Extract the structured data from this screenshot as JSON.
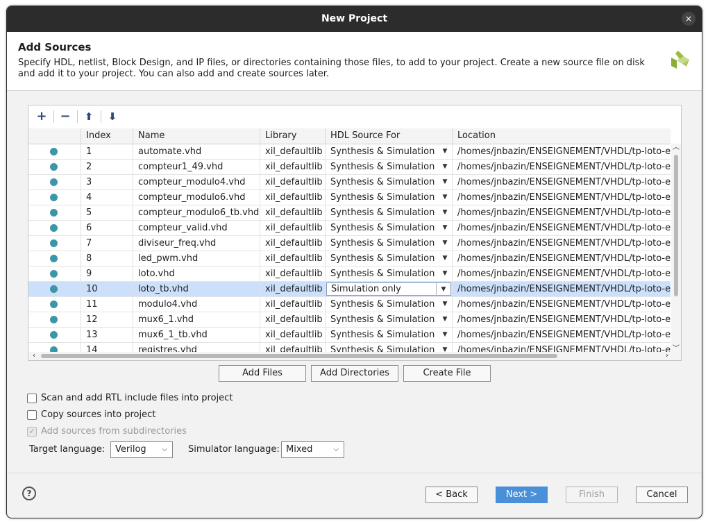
{
  "window": {
    "title": "New Project",
    "close_icon": "×"
  },
  "header": {
    "title": "Add Sources",
    "description": "Specify HDL, netlist, Block Design, and IP files, or directories containing those files, to add to your project. Create a new source file on disk and add it to your project. You can also add and create sources later."
  },
  "toolbar": {
    "add_icon": "+",
    "remove_icon": "−",
    "up_icon": "⬆",
    "down_icon": "⬇"
  },
  "table": {
    "columns": [
      "",
      "Index",
      "Name",
      "Library",
      "HDL Source For",
      "Location"
    ],
    "rows": [
      {
        "index": "1",
        "name": "automate.vhd",
        "library": "xil_defaultlib",
        "source_for": "Synthesis & Simulation",
        "location": "/homes/jnbazin/ENSEIGNEMENT/VHDL/tp-loto-ense"
      },
      {
        "index": "2",
        "name": "compteur1_49.vhd",
        "library": "xil_defaultlib",
        "source_for": "Synthesis & Simulation",
        "location": "/homes/jnbazin/ENSEIGNEMENT/VHDL/tp-loto-ense"
      },
      {
        "index": "3",
        "name": "compteur_modulo4.vhd",
        "library": "xil_defaultlib",
        "source_for": "Synthesis & Simulation",
        "location": "/homes/jnbazin/ENSEIGNEMENT/VHDL/tp-loto-ense"
      },
      {
        "index": "4",
        "name": "compteur_modulo6.vhd",
        "library": "xil_defaultlib",
        "source_for": "Synthesis & Simulation",
        "location": "/homes/jnbazin/ENSEIGNEMENT/VHDL/tp-loto-ense"
      },
      {
        "index": "5",
        "name": "compteur_modulo6_tb.vhd",
        "library": "xil_defaultlib",
        "source_for": "Synthesis & Simulation",
        "location": "/homes/jnbazin/ENSEIGNEMENT/VHDL/tp-loto-ense"
      },
      {
        "index": "6",
        "name": "compteur_valid.vhd",
        "library": "xil_defaultlib",
        "source_for": "Synthesis & Simulation",
        "location": "/homes/jnbazin/ENSEIGNEMENT/VHDL/tp-loto-ense"
      },
      {
        "index": "7",
        "name": "diviseur_freq.vhd",
        "library": "xil_defaultlib",
        "source_for": "Synthesis & Simulation",
        "location": "/homes/jnbazin/ENSEIGNEMENT/VHDL/tp-loto-ense"
      },
      {
        "index": "8",
        "name": "led_pwm.vhd",
        "library": "xil_defaultlib",
        "source_for": "Synthesis & Simulation",
        "location": "/homes/jnbazin/ENSEIGNEMENT/VHDL/tp-loto-ense"
      },
      {
        "index": "9",
        "name": "loto.vhd",
        "library": "xil_defaultlib",
        "source_for": "Synthesis & Simulation",
        "location": "/homes/jnbazin/ENSEIGNEMENT/VHDL/tp-loto-ense"
      },
      {
        "index": "10",
        "name": "loto_tb.vhd",
        "library": "xil_defaultlib",
        "source_for": "Simulation only",
        "location": "/homes/jnbazin/ENSEIGNEMENT/VHDL/tp-loto-ense"
      },
      {
        "index": "11",
        "name": "modulo4.vhd",
        "library": "xil_defaultlib",
        "source_for": "Synthesis & Simulation",
        "location": "/homes/jnbazin/ENSEIGNEMENT/VHDL/tp-loto-ense"
      },
      {
        "index": "12",
        "name": "mux6_1.vhd",
        "library": "xil_defaultlib",
        "source_for": "Synthesis & Simulation",
        "location": "/homes/jnbazin/ENSEIGNEMENT/VHDL/tp-loto-ense"
      },
      {
        "index": "13",
        "name": "mux6_1_tb.vhd",
        "library": "xil_defaultlib",
        "source_for": "Synthesis & Simulation",
        "location": "/homes/jnbazin/ENSEIGNEMENT/VHDL/tp-loto-ense"
      },
      {
        "index": "14",
        "name": "registres.vhd",
        "library": "xil_defaultlib",
        "source_for": "Synthesis & Simulation",
        "location": "/homes/jnbazin/ENSEIGNEMENT/VHDL/tp-loto-ense"
      }
    ],
    "selected_index": "10"
  },
  "actions": {
    "add_files": "Add Files",
    "add_directories": "Add Directories",
    "create_file": "Create File"
  },
  "options": {
    "scan_rtl": {
      "label": "Scan and add RTL include files into project",
      "checked": false
    },
    "copy_sources": {
      "label": "Copy sources into project",
      "checked": false
    },
    "add_subdirs": {
      "label": "Add sources from subdirectories",
      "checked": true,
      "disabled": true
    }
  },
  "languages": {
    "target_label": "Target language:",
    "target_value": "Verilog",
    "simulator_label": "Simulator language:",
    "simulator_value": "Mixed"
  },
  "footer": {
    "help": "?",
    "back": "< Back",
    "next": "Next >",
    "finish": "Finish",
    "cancel": "Cancel"
  },
  "colors": {
    "accent": "#4a90d9",
    "selection": "#cce0fb",
    "status_dot": "#3d96a8",
    "titlebar": "#2c2c2c"
  }
}
